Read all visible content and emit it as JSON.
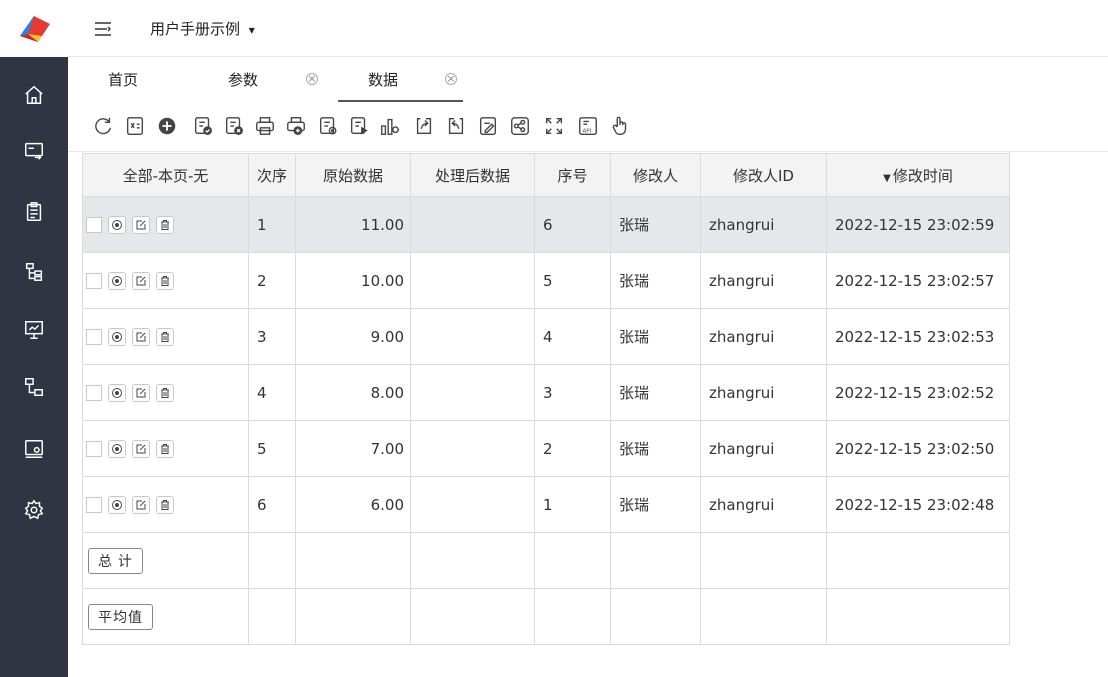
{
  "app": {
    "title": "用户手册示例",
    "title_caret": "▾"
  },
  "sidebar": {
    "logo": "app-logo",
    "items": [
      {
        "icon": "home-icon"
      },
      {
        "icon": "screen-arrow-icon"
      },
      {
        "icon": "clipboard-icon"
      },
      {
        "icon": "tree-icon"
      },
      {
        "icon": "presentation-icon"
      },
      {
        "icon": "org-chart-icon"
      },
      {
        "icon": "monitor-settings-icon"
      },
      {
        "icon": "gear-icon"
      }
    ]
  },
  "tabs": [
    {
      "label": "首页",
      "closable": false
    },
    {
      "label": "参数",
      "closable": true
    },
    {
      "label": "数据",
      "closable": true,
      "active": true
    }
  ],
  "tab_close_glyph": "×",
  "toolbar": {
    "icons": [
      "refresh-icon",
      "export-excel-icon",
      "add-icon",
      "approve-icon",
      "reject-icon",
      "print-icon",
      "print-add-icon",
      "print-settings-icon",
      "run-report-icon",
      "chart-icon",
      "share-out-icon",
      "share-back-icon",
      "edit-doc-icon",
      "share-link-icon",
      "fullscreen-icon",
      "api-icon",
      "hand-pointer-icon"
    ]
  },
  "table": {
    "columns": {
      "select": "全部-本页-无",
      "order": "次序",
      "raw": "原始数据",
      "processed": "处理后数据",
      "seq": "序号",
      "modifier": "修改人",
      "modifier_id": "修改人ID",
      "modified_time": "修改时间"
    },
    "sort_indicator": "▼",
    "rows": [
      {
        "order": "1",
        "raw": "11.00",
        "processed": "",
        "seq": "6",
        "modifier": "张瑞",
        "modifier_id": "zhangrui",
        "modified_time": "2022-12-15 23:02:59",
        "selected": true
      },
      {
        "order": "2",
        "raw": "10.00",
        "processed": "",
        "seq": "5",
        "modifier": "张瑞",
        "modifier_id": "zhangrui",
        "modified_time": "2022-12-15 23:02:57"
      },
      {
        "order": "3",
        "raw": "9.00",
        "processed": "",
        "seq": "4",
        "modifier": "张瑞",
        "modifier_id": "zhangrui",
        "modified_time": "2022-12-15 23:02:53"
      },
      {
        "order": "4",
        "raw": "8.00",
        "processed": "",
        "seq": "3",
        "modifier": "张瑞",
        "modifier_id": "zhangrui",
        "modified_time": "2022-12-15 23:02:52"
      },
      {
        "order": "5",
        "raw": "7.00",
        "processed": "",
        "seq": "2",
        "modifier": "张瑞",
        "modifier_id": "zhangrui",
        "modified_time": "2022-12-15 23:02:50"
      },
      {
        "order": "6",
        "raw": "6.00",
        "processed": "",
        "seq": "1",
        "modifier": "张瑞",
        "modifier_id": "zhangrui",
        "modified_time": "2022-12-15 23:02:48"
      }
    ],
    "summary": {
      "total_label": "总 计",
      "average_label": "平均值"
    }
  }
}
